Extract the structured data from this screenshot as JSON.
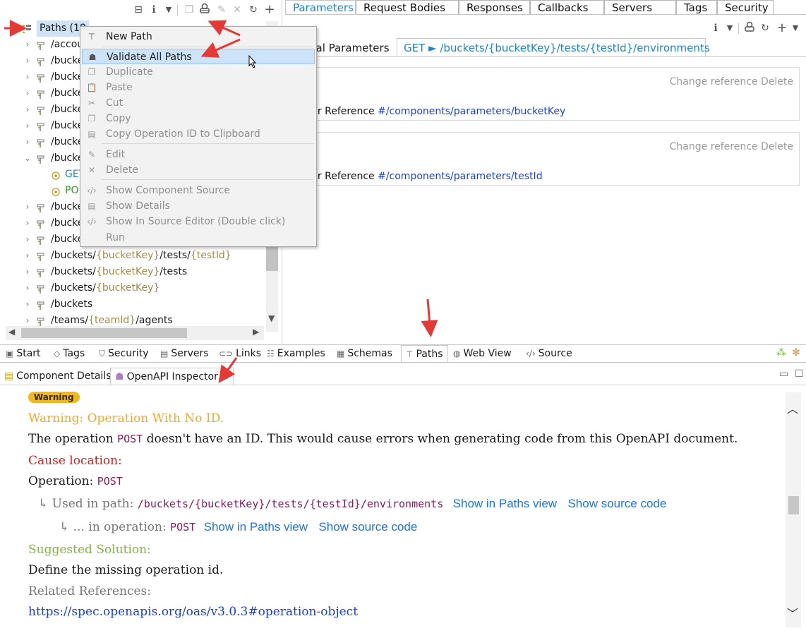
{
  "tree": {
    "root_label": "Paths (18",
    "rows": [
      {
        "parts": [
          {
            "t": "/accou",
            "v": false
          }
        ]
      },
      {
        "parts": [
          {
            "t": "/bucke",
            "v": false
          }
        ]
      },
      {
        "parts": [
          {
            "t": "/bucke",
            "v": false
          }
        ]
      },
      {
        "parts": [
          {
            "t": "/bucke",
            "v": false
          }
        ]
      },
      {
        "parts": [
          {
            "t": "/bucke",
            "v": false
          }
        ]
      },
      {
        "parts": [
          {
            "t": "/bucke",
            "v": false
          }
        ]
      },
      {
        "parts": [
          {
            "t": "/bucke",
            "v": false
          }
        ]
      },
      {
        "parts": [
          {
            "t": "/bucke",
            "v": false
          }
        ],
        "expanded": true
      },
      {
        "parts": [
          {
            "t": "GET",
            "v": false
          }
        ],
        "op": "get"
      },
      {
        "parts": [
          {
            "t": "PO",
            "v": false
          }
        ],
        "op": "post"
      },
      {
        "parts": [
          {
            "t": "/bucke",
            "v": false
          }
        ]
      },
      {
        "parts": [
          {
            "t": "/bucke",
            "v": false
          }
        ]
      },
      {
        "parts": [
          {
            "t": "/bucke",
            "v": false
          }
        ]
      },
      {
        "parts": [
          {
            "t": "/buckets/",
            "v": false
          },
          {
            "t": "{bucketKey}",
            "v": true
          },
          {
            "t": "/tests/",
            "v": false
          },
          {
            "t": "{testId}",
            "v": true
          }
        ]
      },
      {
        "parts": [
          {
            "t": "/buckets/",
            "v": false
          },
          {
            "t": "{bucketKey}",
            "v": true
          },
          {
            "t": "/tests",
            "v": false
          }
        ]
      },
      {
        "parts": [
          {
            "t": "/buckets/",
            "v": false
          },
          {
            "t": "{bucketKey}",
            "v": true
          }
        ]
      },
      {
        "parts": [
          {
            "t": "/buckets",
            "v": false
          }
        ]
      },
      {
        "parts": [
          {
            "t": "/teams/",
            "v": false
          },
          {
            "t": "{teamId}",
            "v": true
          },
          {
            "t": "/agents",
            "v": false
          }
        ]
      }
    ]
  },
  "context_menu": {
    "items": [
      {
        "label": "New Path",
        "icon": "path-icon",
        "state": "enabled"
      },
      {
        "label": "Validate All Paths",
        "icon": "inspector-icon",
        "state": "selected"
      },
      {
        "label": "Duplicate",
        "icon": "duplicate-icon",
        "state": "disabled"
      },
      {
        "label": "Paste",
        "icon": "paste-icon",
        "state": "disabled"
      },
      {
        "label": "Cut",
        "icon": "cut-icon",
        "state": "disabled"
      },
      {
        "label": "Copy",
        "icon": "copy-icon",
        "state": "disabled"
      },
      {
        "label": "Copy Operation ID to Clipboard",
        "icon": "clipboard-icon",
        "state": "disabled"
      },
      {
        "label": "Edit",
        "icon": "edit-icon",
        "state": "disabled"
      },
      {
        "label": "Delete",
        "icon": "delete-icon",
        "state": "disabled"
      },
      {
        "label": "Show Component Source",
        "icon": "source-icon",
        "state": "disabled"
      },
      {
        "label": "Show Details",
        "icon": "details-icon",
        "state": "disabled"
      },
      {
        "label": "Show In Source Editor (Double click)",
        "icon": "source-icon",
        "state": "disabled"
      },
      {
        "label": "Run",
        "icon": "",
        "state": "disabled"
      }
    ]
  },
  "editor": {
    "tabs": [
      "Parameters",
      "Request Bodies",
      "Responses",
      "Callbacks",
      "Servers",
      "Tags",
      "Security"
    ],
    "active_tab": "Parameters",
    "subtab_global": "bal Parameters",
    "subtab_op": "GET ► /buckets/{bucketKey}/tests/{testId}/environments",
    "cards": [
      {
        "actions": "Change reference Delete",
        "ref_label": "ameter Reference ",
        "ref_value": "#/components/parameters/bucketKey"
      },
      {
        "actions": "Change reference Delete",
        "ref_label": "ameter Reference ",
        "ref_value": "#/components/parameters/testId"
      }
    ]
  },
  "bottom_tabs": [
    "Start",
    "Tags",
    "Security",
    "Servers",
    "Links",
    "Examples",
    "Schemas",
    "Paths",
    "Web View",
    "Source"
  ],
  "bottom_active": "Paths",
  "inspector": {
    "tabs": [
      "Component Details",
      "OpenAPI Inspector"
    ],
    "badge": "Warning",
    "title": "Warning: Operation With No ID.",
    "desc_pre": "The operation ",
    "desc_code": "POST",
    "desc_post": " doesn't have an ID. This would cause errors when generating code from this OpenAPI document.",
    "cause_label": "Cause location:",
    "operation_label": "Operation: ",
    "operation_code": "POST",
    "used_in_label": "↳ Used in path: ",
    "used_in_path": "/buckets/{bucketKey}/tests/{testId}/environments",
    "show_in_paths": "Show in Paths view",
    "show_source": "Show source code",
    "in_op_label": "↳ ... in operation: ",
    "in_op_code": "POST",
    "solution_label": "Suggested Solution:",
    "solution_text": "Define the missing operation id.",
    "related_label": "Related References:",
    "related_link": "https://spec.openapis.org/oas/v3.0.3#operation-object"
  },
  "colors": {
    "warning": "#f2a92a",
    "cause": "#e21a1a",
    "solution": "#7fb63a",
    "link": "#1a73e8",
    "selection": "#cce3f8",
    "arrow": "#e53935"
  }
}
